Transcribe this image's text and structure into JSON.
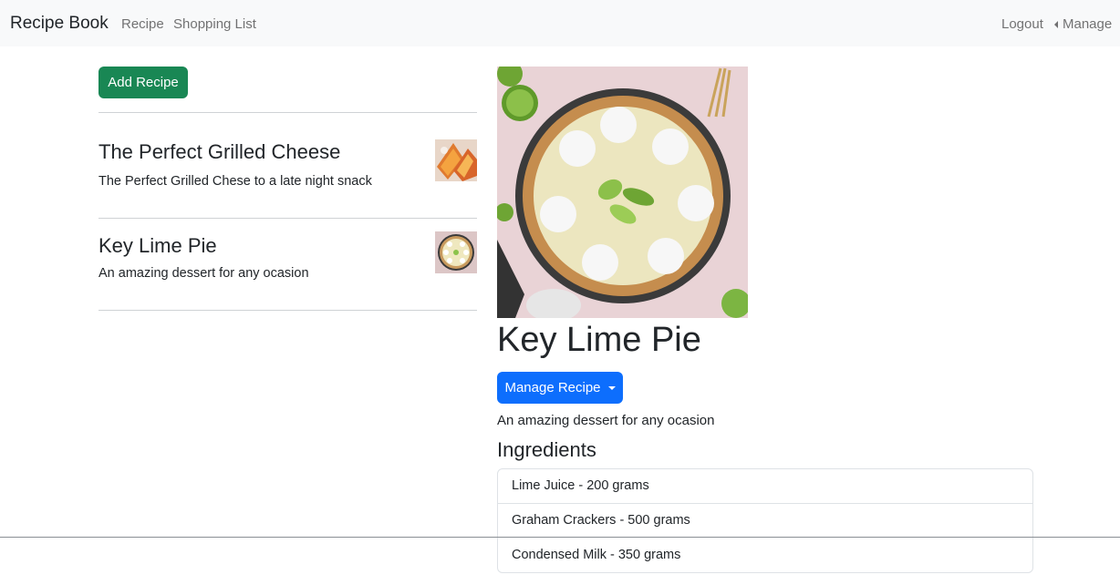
{
  "navbar": {
    "brand": "Recipe Book",
    "links": {
      "recipe": "Recipe",
      "shopping_list": "Shopping List",
      "logout": "Logout",
      "manage": "Manage"
    }
  },
  "sidebar": {
    "add_button": "Add Recipe",
    "recipes": [
      {
        "title": "The Perfect Grilled Cheese",
        "description": "The Perfect Grilled Chese to a late night snack"
      },
      {
        "title": "Key Lime Pie",
        "description": "An amazing dessert for any ocasion"
      }
    ]
  },
  "detail": {
    "title": "Key Lime Pie",
    "manage_button": "Manage Recipe",
    "description": "An amazing dessert for any ocasion",
    "ingredients_heading": "Ingredients",
    "ingredients": [
      "Lime Juice - 200 grams",
      "Graham Crackers - 500 grams",
      "Condensed Milk - 350 grams"
    ]
  },
  "colors": {
    "success": "#198754",
    "primary": "#0d6efd",
    "navbar_bg": "#f8f9fa"
  }
}
